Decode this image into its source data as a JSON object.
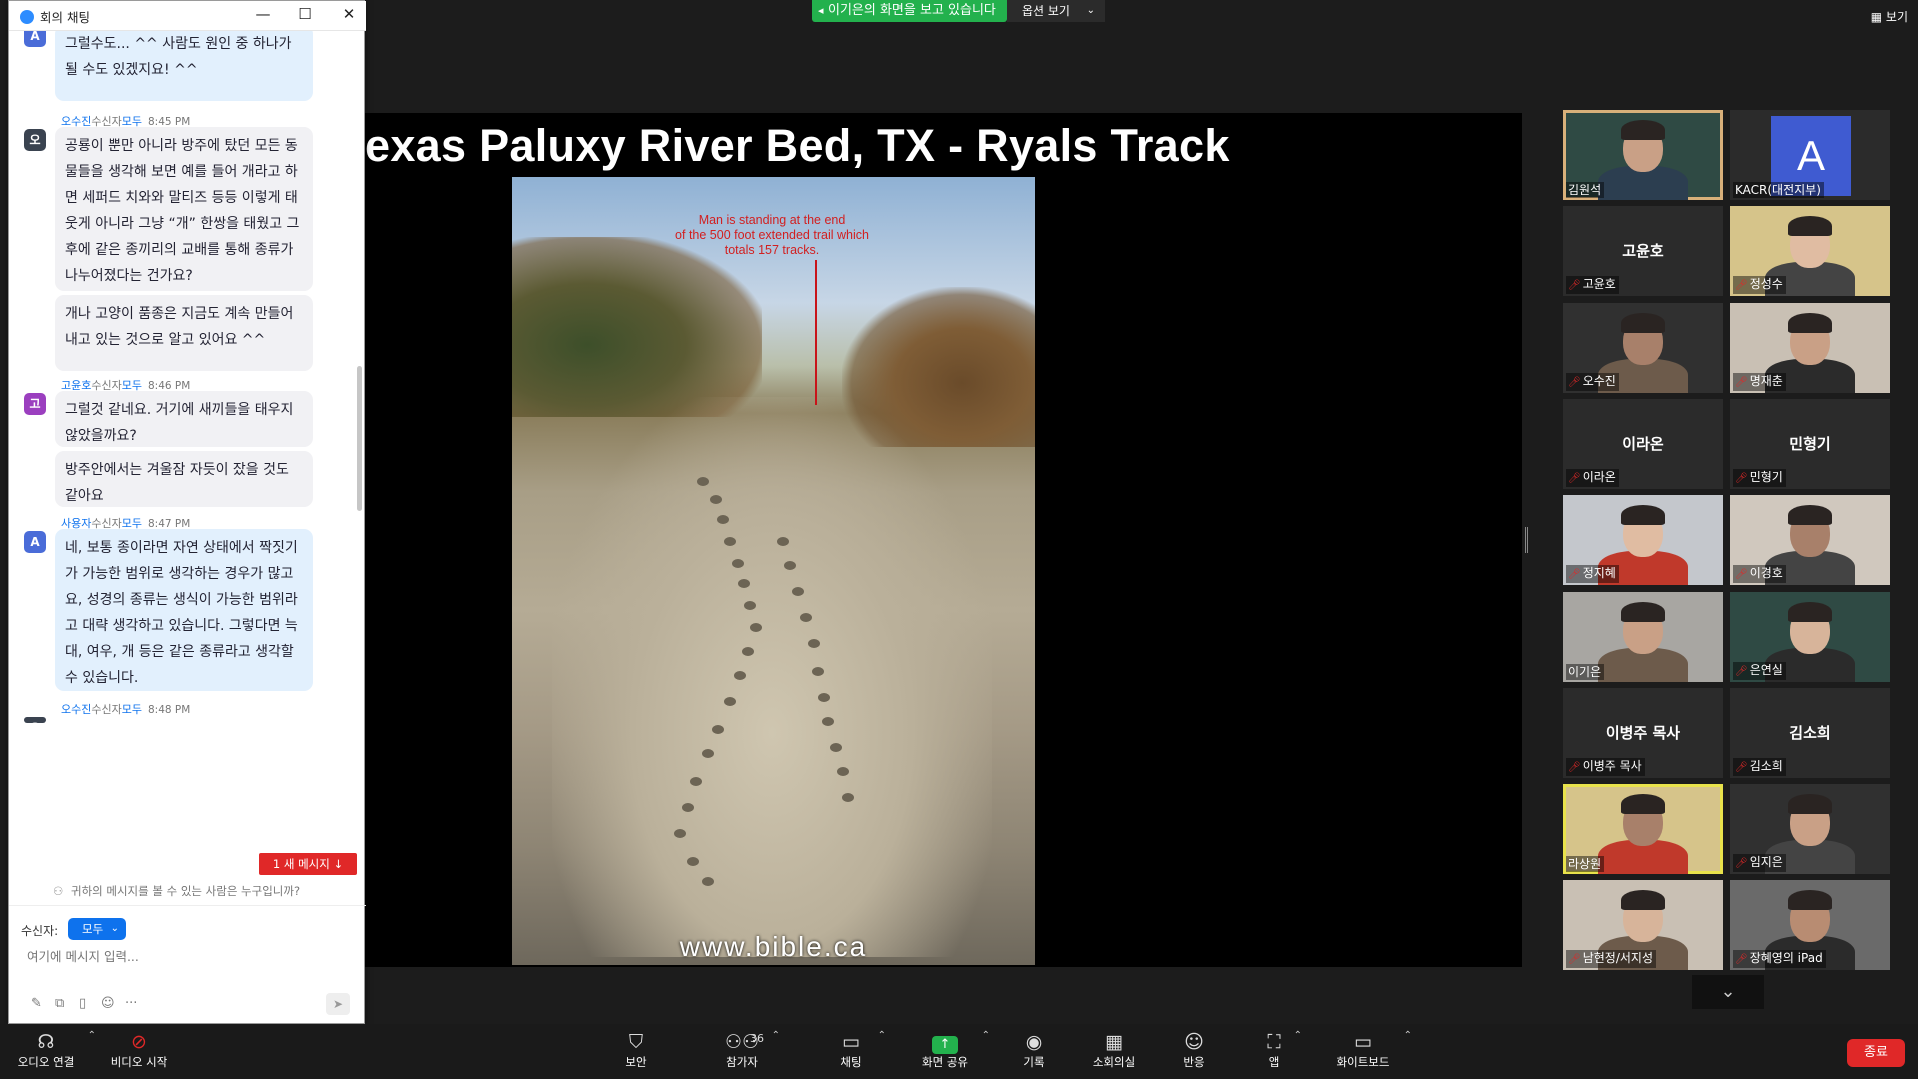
{
  "top": {
    "share_banner": "이기은의 화면을 보고 있습니다",
    "view_options": "옵션 보기",
    "view": "보기"
  },
  "slide": {
    "title": "exas Paluxy River Bed, TX - Ryals Track",
    "caption_lines": [
      "Man is standing at the end",
      "of the 500 foot extended trail which",
      "totals 157 tracks."
    ],
    "watermark": "www.bible.ca"
  },
  "chat": {
    "window_title": "회의 채팅",
    "messages": [
      {
        "sender": "",
        "to": "",
        "time": "",
        "avatar": "A",
        "avatar_color": "#4a6cd8",
        "bubbles": [
          {
            "style": "blue",
            "text": "그럴수도... ^^ 사람도 원인 중 하나가 될 수도 있겠지요! ^^"
          }
        ]
      },
      {
        "sender": "오수진",
        "to_label": "수신자",
        "to": "모두",
        "time": "8:45 PM",
        "avatar": "오",
        "avatar_color": "#3a4350",
        "bubbles": [
          {
            "style": "gray",
            "text": "공룡이 뿐만 아니라 방주에 탔던 모든 동물들을 생각해 보면 예를 들어 개라고 하면 세퍼드 치와와 말티즈 등등 이렇게 태웃게 아니라 그냥 “개” 한쌍을 태웠고 그 후에 같은 종끼리의 교배를 통해 종류가 나누어졌다는 건가요?"
          },
          {
            "style": "gray",
            "text": "개나 고양이 품종은 지금도 계속 만들어 내고 있는 것으로 알고 있어요 ^^"
          }
        ]
      },
      {
        "sender": "고윤호",
        "to_label": "수신자",
        "to": "모두",
        "time": "8:46 PM",
        "avatar": "고",
        "avatar_color": "#9b3fbf",
        "bubbles": [
          {
            "style": "gray",
            "text": "그럴것 같네요. 거기에 새끼들을 태우지 않았을까요?"
          },
          {
            "style": "gray",
            "text": "방주안에서는 겨울잠 자듯이 잤을 것도 같아요"
          }
        ]
      },
      {
        "sender": "사용자",
        "to_label": "수신자",
        "to": "모두",
        "time": "8:47 PM",
        "avatar": "A",
        "avatar_color": "#4a6cd8",
        "bubbles": [
          {
            "style": "blue",
            "text": "네, 보통 종이라면 자연 상태에서 짝짓기가 가능한 범위로 생각하는 경우가 많고요, 성경의 종류는 생식이 가능한 범위라고 대략 생각하고 있습니다. 그렇다면 늑대, 여우, 개 등은 같은 종류라고 생각할 수 있습니다."
          }
        ]
      },
      {
        "sender": "오수진",
        "to_label": "수신자",
        "to": "모두",
        "time": "8:48 PM",
        "avatar": "오",
        "avatar_color": "#3a4350",
        "bubbles": []
      }
    ],
    "new_message_label": "1 새 메시지",
    "who_can_see": "귀하의 메시지를 볼 수 있는 사람은 누구입니까?",
    "recipient_label": "수신자:",
    "recipient_value": "모두",
    "input_placeholder": "여기에 메시지 입력..."
  },
  "gallery": [
    {
      "name": "김원석",
      "type": "video",
      "muted": false,
      "framed": true
    },
    {
      "name": "KACR(대전지부)",
      "type": "avatar",
      "letter": "A",
      "muted": false
    },
    {
      "name": "고윤호",
      "type": "name",
      "muted": true
    },
    {
      "name": "정성수",
      "type": "video",
      "muted": true
    },
    {
      "name": "오수진",
      "type": "video",
      "muted": true
    },
    {
      "name": "명재춘",
      "type": "video",
      "muted": true
    },
    {
      "name": "이라온",
      "type": "name",
      "muted": true
    },
    {
      "name": "민형기",
      "type": "name",
      "muted": true
    },
    {
      "name": "정지혜",
      "type": "video",
      "muted": true
    },
    {
      "name": "이경호",
      "type": "video",
      "muted": true
    },
    {
      "name": "이기은",
      "type": "video",
      "muted": false
    },
    {
      "name": "은연실",
      "type": "video",
      "muted": true
    },
    {
      "name": "이병주 목사",
      "type": "name",
      "muted": true
    },
    {
      "name": "김소희",
      "type": "name",
      "muted": true
    },
    {
      "name": "라상원",
      "type": "video",
      "muted": false,
      "active": true
    },
    {
      "name": "임지은",
      "type": "video",
      "muted": true
    },
    {
      "name": "남현정/서지성",
      "type": "video",
      "muted": true
    },
    {
      "name": "장혜영의 iPad",
      "type": "video",
      "muted": true
    }
  ],
  "toolbar": {
    "audio": "오디오 연결",
    "video": "비디오 시작",
    "security": "보안",
    "participants": "참가자",
    "participants_count": "36",
    "chat": "채팅",
    "share": "화면 공유",
    "record": "기록",
    "breakout": "소회의실",
    "reactions": "반응",
    "apps": "앱",
    "whiteboard": "화이트보드",
    "end": "종료"
  }
}
